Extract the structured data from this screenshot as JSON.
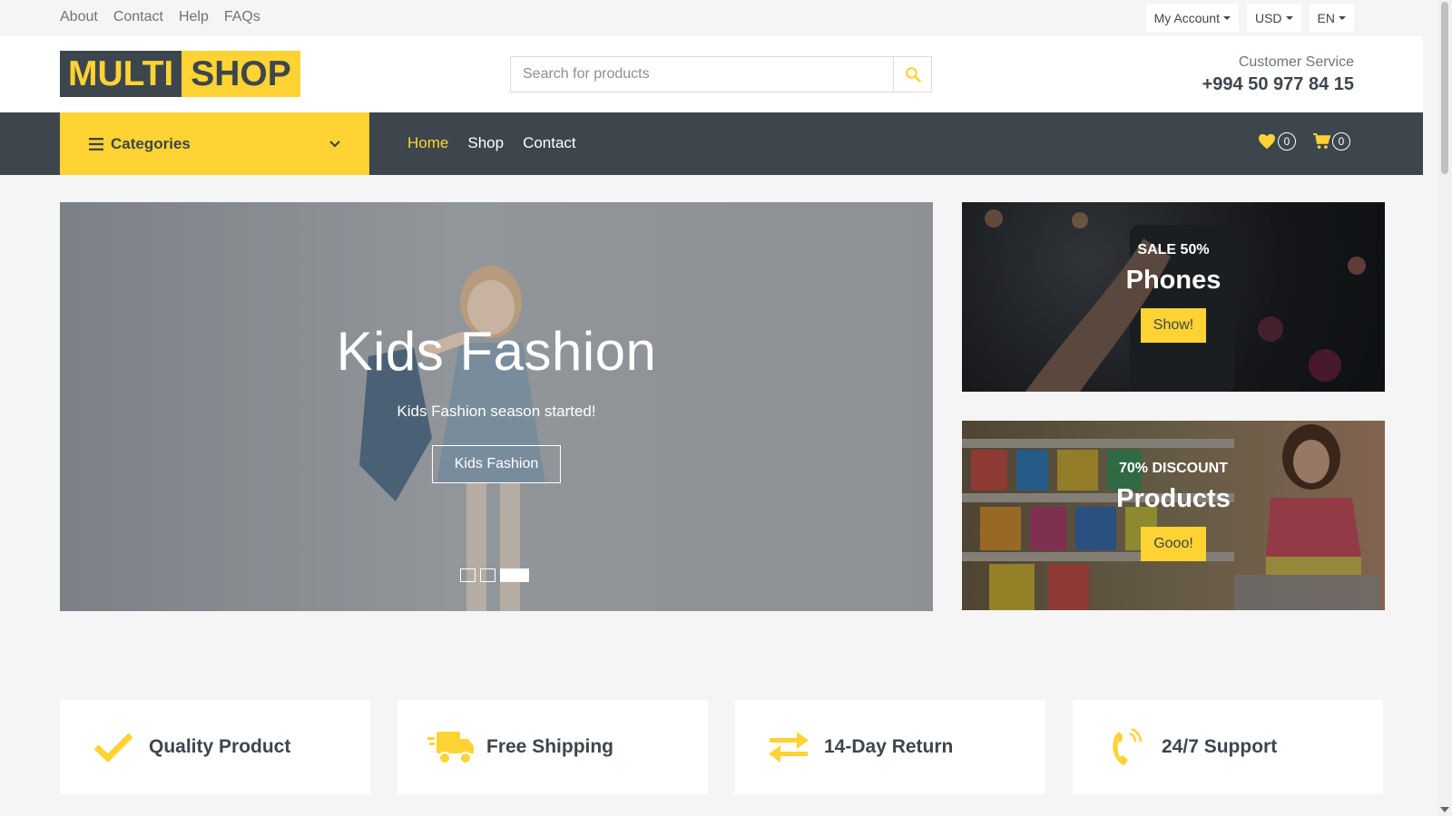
{
  "topbar": {
    "links": [
      "About",
      "Contact",
      "Help",
      "FAQs"
    ],
    "account_label": "My Account",
    "currency_label": "USD",
    "language_label": "EN"
  },
  "header": {
    "logo_part1": "MULTI",
    "logo_part2": "SHOP",
    "search_placeholder": "Search for products",
    "customer_service_label": "Customer Service",
    "customer_service_phone": "+994 50 977 84 15"
  },
  "nav": {
    "categories_label": "Categories",
    "links": [
      "Home",
      "Shop",
      "Contact"
    ],
    "active_link": "Home",
    "wishlist_count": "0",
    "cart_count": "0"
  },
  "carousel": {
    "title": "Kids Fashion",
    "subtitle": "Kids Fashion season started!",
    "button_label": "Kids Fashion",
    "slide_count": 3,
    "active_slide": 3
  },
  "offers": [
    {
      "tag": "SALE 50%",
      "title": "Phones",
      "button": "Show!"
    },
    {
      "tag": "70% DISCOUNT",
      "title": "Products",
      "button": "Gooo!"
    }
  ],
  "features": [
    {
      "label": "Quality Product",
      "icon": "check-icon"
    },
    {
      "label": "Free Shipping",
      "icon": "truck-icon"
    },
    {
      "label": "14-Day Return",
      "icon": "exchange-icon"
    },
    {
      "label": "24/7 Support",
      "icon": "phone-volume-icon"
    }
  ],
  "colors": {
    "accent": "#ffd333",
    "dark": "#3d464d",
    "background": "#f5f5f5"
  }
}
